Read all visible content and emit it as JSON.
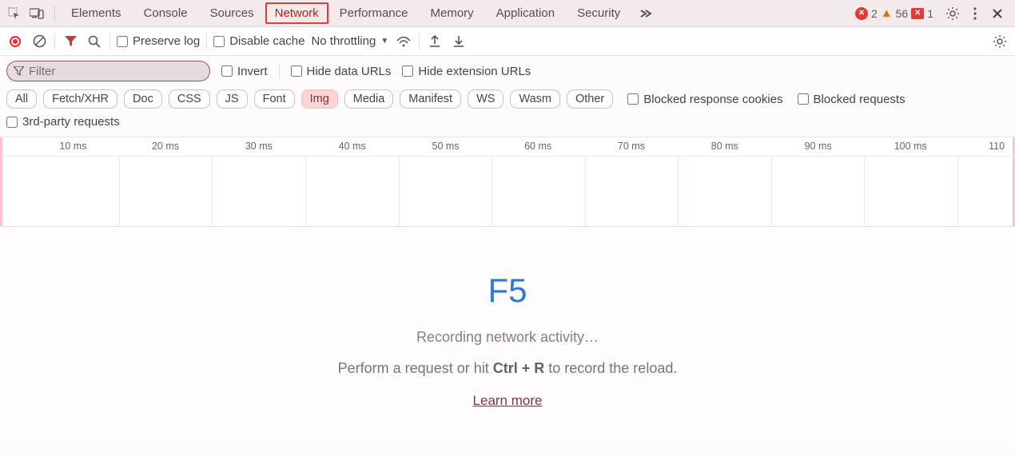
{
  "tabs": {
    "items": [
      "Elements",
      "Console",
      "Sources",
      "Network",
      "Performance",
      "Memory",
      "Application",
      "Security"
    ],
    "active_index": 3
  },
  "status": {
    "errors": "2",
    "warnings": "56",
    "messages": "1"
  },
  "toolbar": {
    "preserve_log": "Preserve log",
    "disable_cache": "Disable cache",
    "throttling": "No throttling"
  },
  "filter": {
    "placeholder": "Filter",
    "invert": "Invert",
    "hide_data_urls": "Hide data URLs",
    "hide_ext_urls": "Hide extension URLs"
  },
  "chips": {
    "items": [
      "All",
      "Fetch/XHR",
      "Doc",
      "CSS",
      "JS",
      "Font",
      "Img",
      "Media",
      "Manifest",
      "WS",
      "Wasm",
      "Other"
    ],
    "active_index": 6,
    "blocked_cookies": "Blocked response cookies",
    "blocked_requests": "Blocked requests"
  },
  "third": {
    "third_party": "3rd-party requests"
  },
  "timeline": {
    "labels": [
      "10 ms",
      "20 ms",
      "30 ms",
      "40 ms",
      "50 ms",
      "60 ms",
      "70 ms",
      "80 ms",
      "90 ms",
      "100 ms",
      "110"
    ],
    "positions_pct": [
      7.2,
      16.3,
      25.5,
      34.7,
      43.9,
      53.0,
      62.2,
      71.4,
      80.6,
      89.7,
      98.2
    ],
    "grid_positions_pct": [
      11.7,
      20.9,
      30.1,
      39.3,
      48.4,
      57.6,
      66.8,
      76.0,
      85.1,
      94.3
    ]
  },
  "empty": {
    "kbd": "F5",
    "recording": "Recording network activity…",
    "prefix": "Perform a request or hit ",
    "shortcut": "Ctrl + R",
    "suffix": " to record the reload.",
    "learn": "Learn more"
  }
}
